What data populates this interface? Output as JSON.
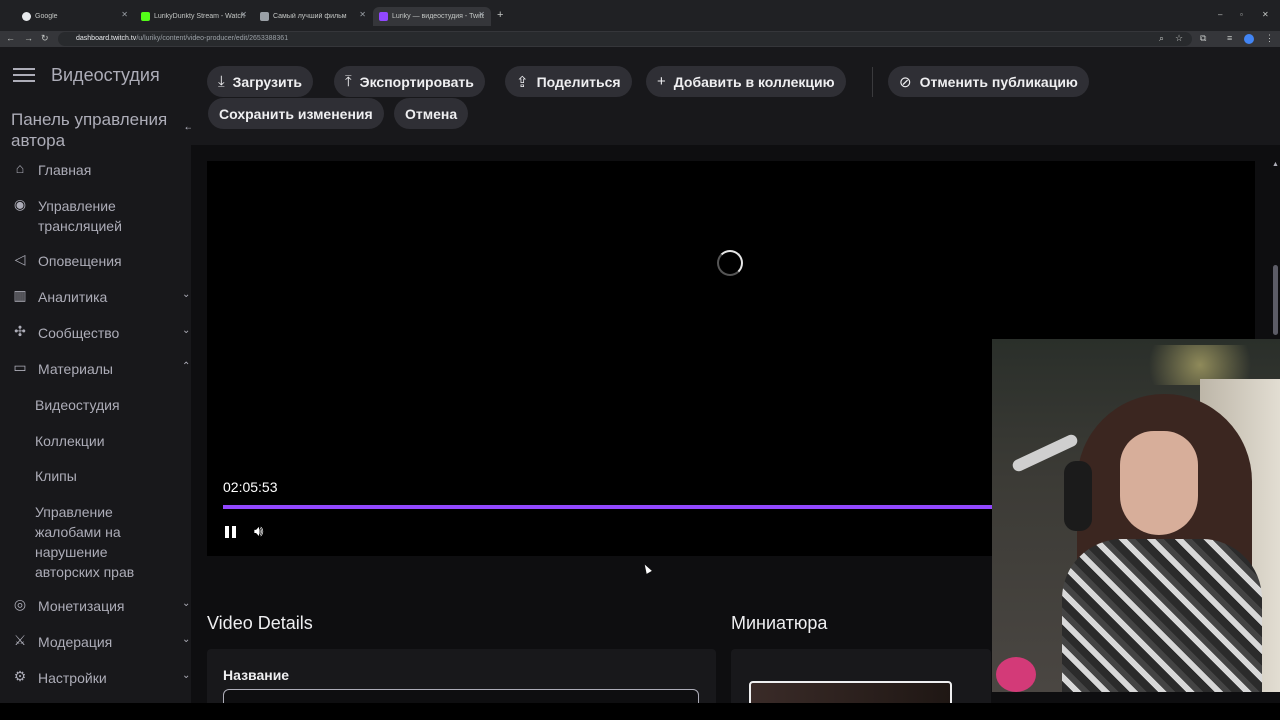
{
  "browser": {
    "tabs": [
      {
        "title": "Google",
        "color": "#e8eaed",
        "active": false
      },
      {
        "title": "LurikyDurikty Stream - Watch Li",
        "color": "#53fc18",
        "active": false
      },
      {
        "title": "Самый лучший фильм",
        "color": "#9aa0a6",
        "active": false
      },
      {
        "title": "Luriky — видеостудия - Twitch",
        "color": "#9147ff",
        "active": true
      }
    ],
    "new_tab": "+",
    "url_host": "dashboard.twitch.tv",
    "url_path": "/u/luriky/content/video-producer/edit/2653388361",
    "window_controls": {
      "minimize": "–",
      "maximize": "▫",
      "close": "✕"
    }
  },
  "sidebar": {
    "header": "Видеостудия",
    "panel_title": "Панель управления автора",
    "items": [
      {
        "label": "Главная",
        "icon": "home-icon",
        "glyph": "⌂"
      },
      {
        "label": "Управление трансляцией",
        "icon": "broadcast-icon",
        "glyph": "◉"
      },
      {
        "label": "Оповещения",
        "icon": "megaphone-icon",
        "glyph": "◁"
      },
      {
        "label": "Аналитика",
        "icon": "chart-icon",
        "glyph": "▥"
      },
      {
        "label": "Сообщество",
        "icon": "community-icon",
        "glyph": "✣"
      },
      {
        "label": "Материалы",
        "icon": "content-icon",
        "glyph": "▭"
      },
      {
        "label": "Монетизация",
        "icon": "money-icon",
        "glyph": "◎"
      },
      {
        "label": "Модерация",
        "icon": "sword-icon",
        "glyph": "⚔"
      },
      {
        "label": "Настройки",
        "icon": "gear-icon",
        "glyph": "⚙"
      }
    ],
    "subitems": [
      "Видеостудия",
      "Коллекции",
      "Клипы",
      "Управление жалобами на нарушение авторских прав"
    ]
  },
  "toolbar": {
    "download": "Загрузить",
    "export": "Экспортировать",
    "share": "Поделиться",
    "add_collection": "Добавить в коллекцию",
    "unpublish": "Отменить публикацию",
    "save": "Сохранить изменения",
    "cancel": "Отмена"
  },
  "player": {
    "timecode": "02:05:53",
    "progress_fraction": 1.0
  },
  "details": {
    "title": "Video Details",
    "name_label": "Название"
  },
  "thumbnail": {
    "title": "Миниатюра"
  },
  "colors": {
    "accent": "#9147ff",
    "background": "#0e0e10",
    "surface": "#18181b"
  }
}
